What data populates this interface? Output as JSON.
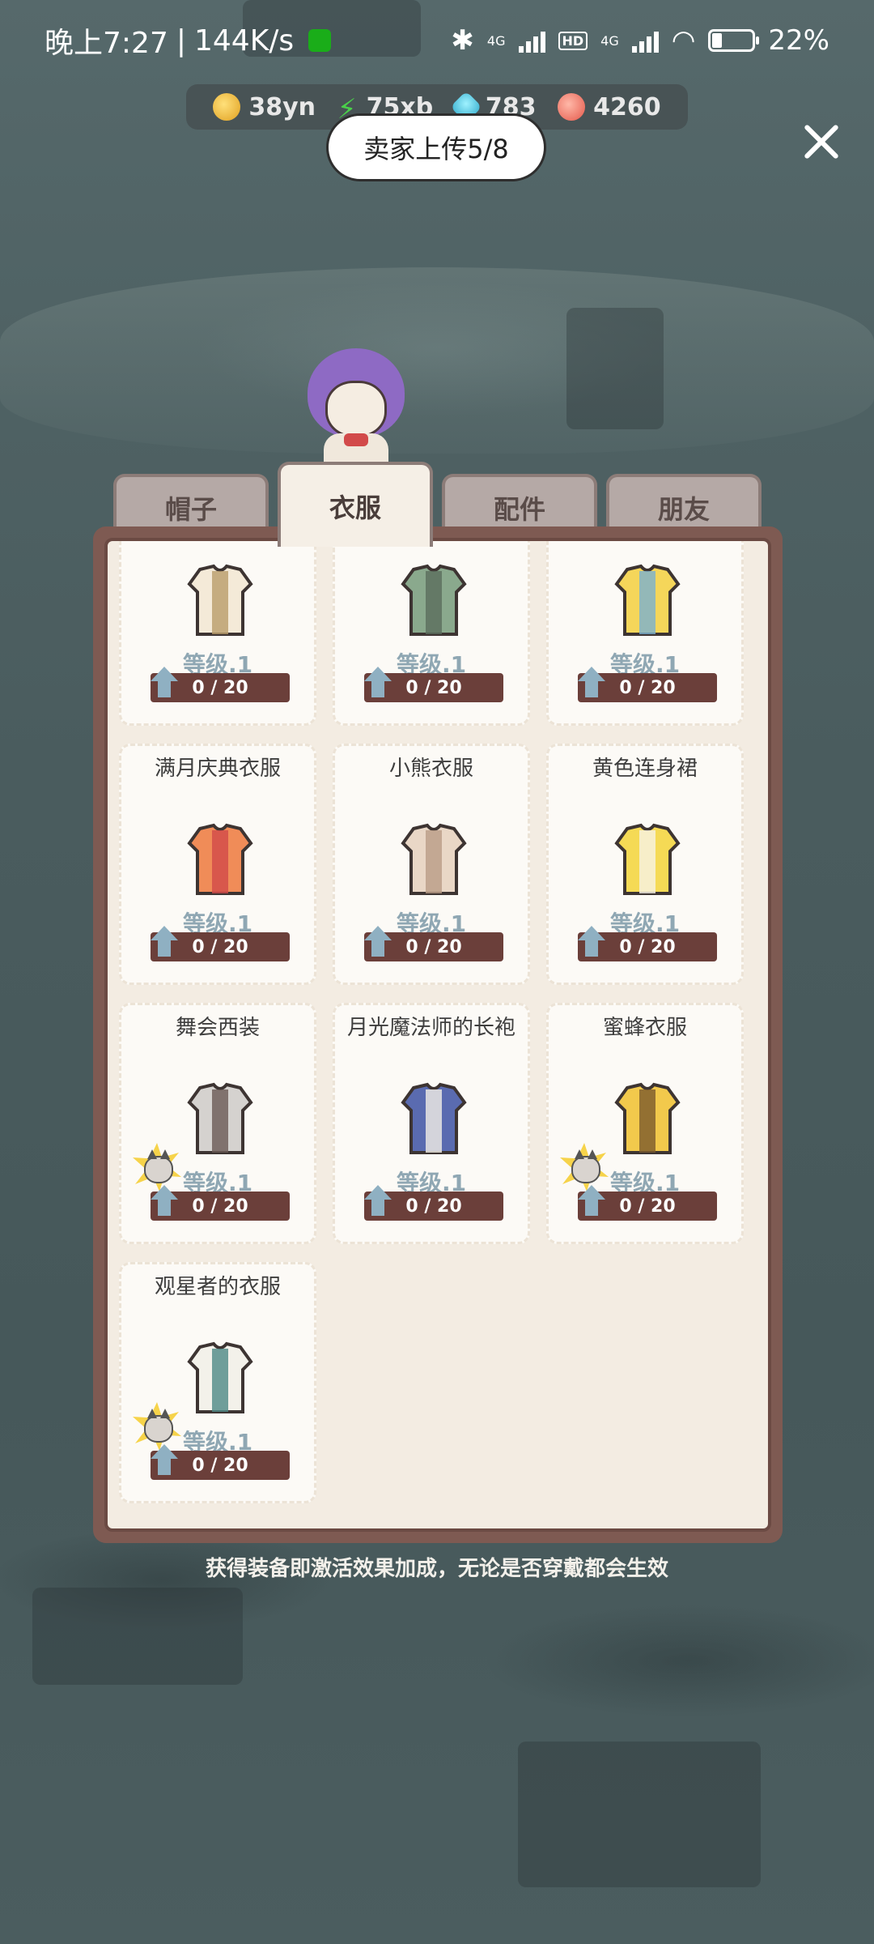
{
  "status_bar": {
    "time": "晚上7:27",
    "separator": "|",
    "speed": "144K/s",
    "net1": "4G",
    "hd": "HD",
    "net2": "4G",
    "battery": "22%"
  },
  "resources": [
    {
      "icon": "coin-icon",
      "value": "38yn"
    },
    {
      "icon": "energy-icon",
      "value": "75xb"
    },
    {
      "icon": "gem-icon",
      "value": "783"
    },
    {
      "icon": "candy-icon",
      "value": "4260"
    }
  ],
  "seller_label": "卖家上传5/8",
  "tabs": [
    {
      "label": "帽子",
      "active": false
    },
    {
      "label": "衣服",
      "active": true
    },
    {
      "label": "配件",
      "active": false
    },
    {
      "label": "朋友",
      "active": false
    }
  ],
  "items": [
    {
      "name": "",
      "level": "等级.1",
      "progress": "0 / 20",
      "progress_value": 0,
      "progress_max": 20,
      "image": "vest-cream-icon",
      "cat": false
    },
    {
      "name": "",
      "level": "等级.1",
      "progress": "0 / 20",
      "progress_value": 0,
      "progress_max": 20,
      "image": "kimono-green-icon",
      "cat": false
    },
    {
      "name": "",
      "level": "等级.1",
      "progress": "0 / 20",
      "progress_value": 0,
      "progress_max": 20,
      "image": "dress-yellow-denim-icon",
      "cat": false
    },
    {
      "name": "满月庆典衣服",
      "level": "等级.1",
      "progress": "0 / 20",
      "progress_value": 0,
      "progress_max": 20,
      "image": "festival-outfit-icon",
      "cat": false
    },
    {
      "name": "小熊衣服",
      "level": "等级.1",
      "progress": "0 / 20",
      "progress_value": 0,
      "progress_max": 20,
      "image": "bear-outfit-icon",
      "cat": false
    },
    {
      "name": "黄色连身裙",
      "level": "等级.1",
      "progress": "0 / 20",
      "progress_value": 0,
      "progress_max": 20,
      "image": "yellow-dress-icon",
      "cat": false
    },
    {
      "name": "舞会西装",
      "level": "等级.1",
      "progress": "0 / 20",
      "progress_value": 0,
      "progress_max": 20,
      "image": "ball-suit-icon",
      "cat": true
    },
    {
      "name": "月光魔法师的长袍",
      "level": "等级.1",
      "progress": "0 / 20",
      "progress_value": 0,
      "progress_max": 20,
      "image": "moon-robe-icon",
      "cat": false
    },
    {
      "name": "蜜蜂衣服",
      "level": "等级.1",
      "progress": "0 / 20",
      "progress_value": 0,
      "progress_max": 20,
      "image": "bee-outfit-icon",
      "cat": true
    },
    {
      "name": "观星者的衣服",
      "level": "等级.1",
      "progress": "0 / 20",
      "progress_value": 0,
      "progress_max": 20,
      "image": "stargazer-outfit-icon",
      "cat": true
    }
  ],
  "footer_note": "获得装备即激活效果加成，无论是否穿戴都会生效",
  "colors": {
    "panel_frame": "#7e5a52",
    "panel_bg": "#f3ece2",
    "progress_bar": "#6b3f3a",
    "level_text": "#8fa7b3"
  }
}
